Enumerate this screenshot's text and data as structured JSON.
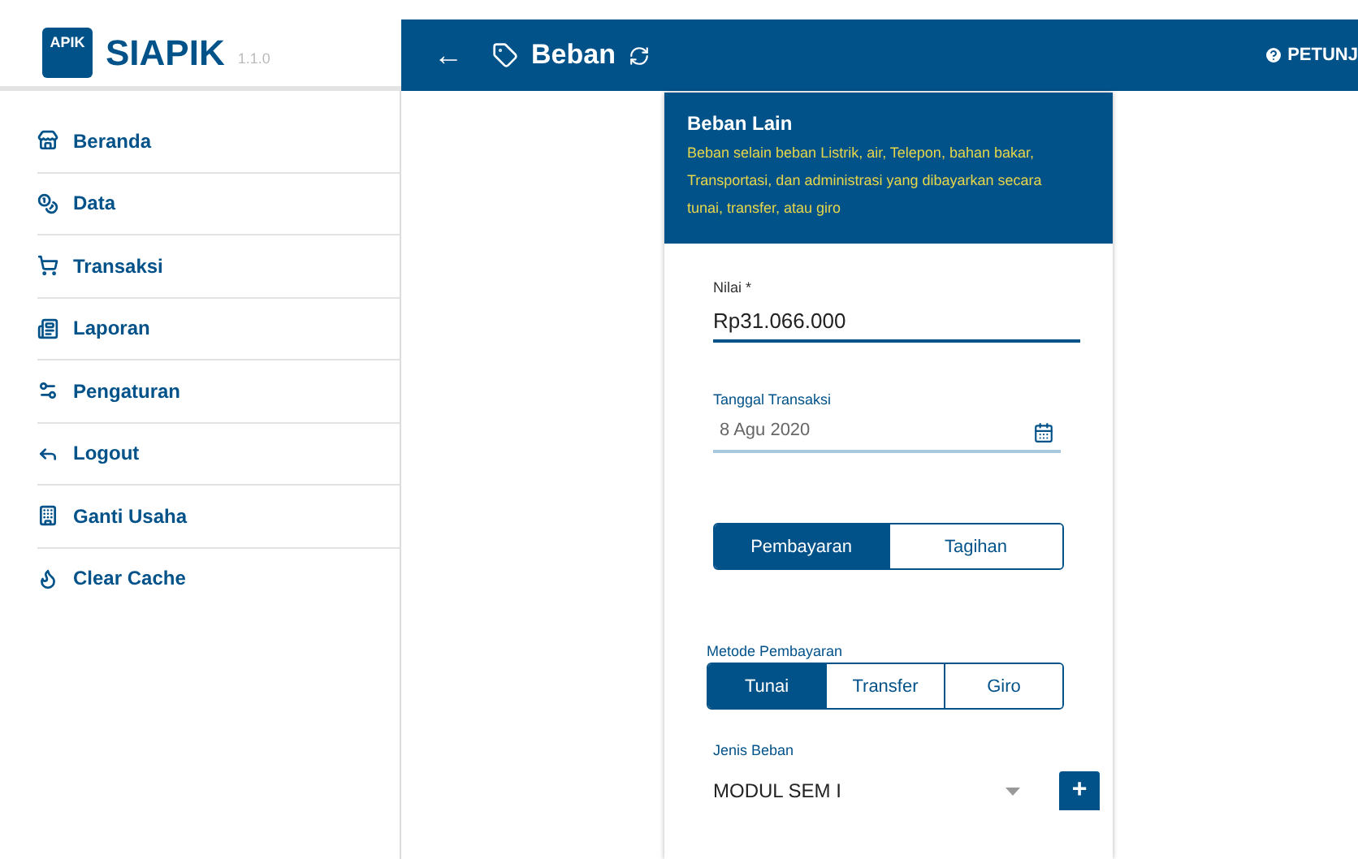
{
  "app": {
    "name": "SIAPIK",
    "version": "1.1.0",
    "logo_text": "APIK"
  },
  "header": {
    "back": "←",
    "title": "Beban",
    "help": "PETUNJ"
  },
  "sidebar": {
    "items": [
      {
        "label": "Beranda"
      },
      {
        "label": "Data"
      },
      {
        "label": "Transaksi"
      },
      {
        "label": "Laporan"
      },
      {
        "label": "Pengaturan"
      },
      {
        "label": "Logout"
      },
      {
        "label": "Ganti Usaha"
      },
      {
        "label": "Clear Cache"
      }
    ]
  },
  "card": {
    "title": "Beban Lain",
    "description": "Beban selain beban Listrik, air, Telepon, bahan bakar, Transportasi, dan administrasi yang dibayarkan secara tunai, transfer, atau giro",
    "nilai": {
      "label": "Nilai *",
      "value": "Rp31.066.000"
    },
    "tanggal": {
      "label": "Tanggal Transaksi",
      "value": "8 Agu 2020"
    },
    "type_toggle": [
      {
        "label": "Pembayaran",
        "selected": true
      },
      {
        "label": "Tagihan",
        "selected": false
      }
    ],
    "metode": {
      "label": "Metode Pembayaran",
      "options": [
        {
          "label": "Tunai",
          "selected": true
        },
        {
          "label": "Transfer",
          "selected": false
        },
        {
          "label": "Giro",
          "selected": false
        }
      ]
    },
    "jenis": {
      "label": "Jenis Beban",
      "value": "MODUL SEM I",
      "add": "+"
    }
  }
}
